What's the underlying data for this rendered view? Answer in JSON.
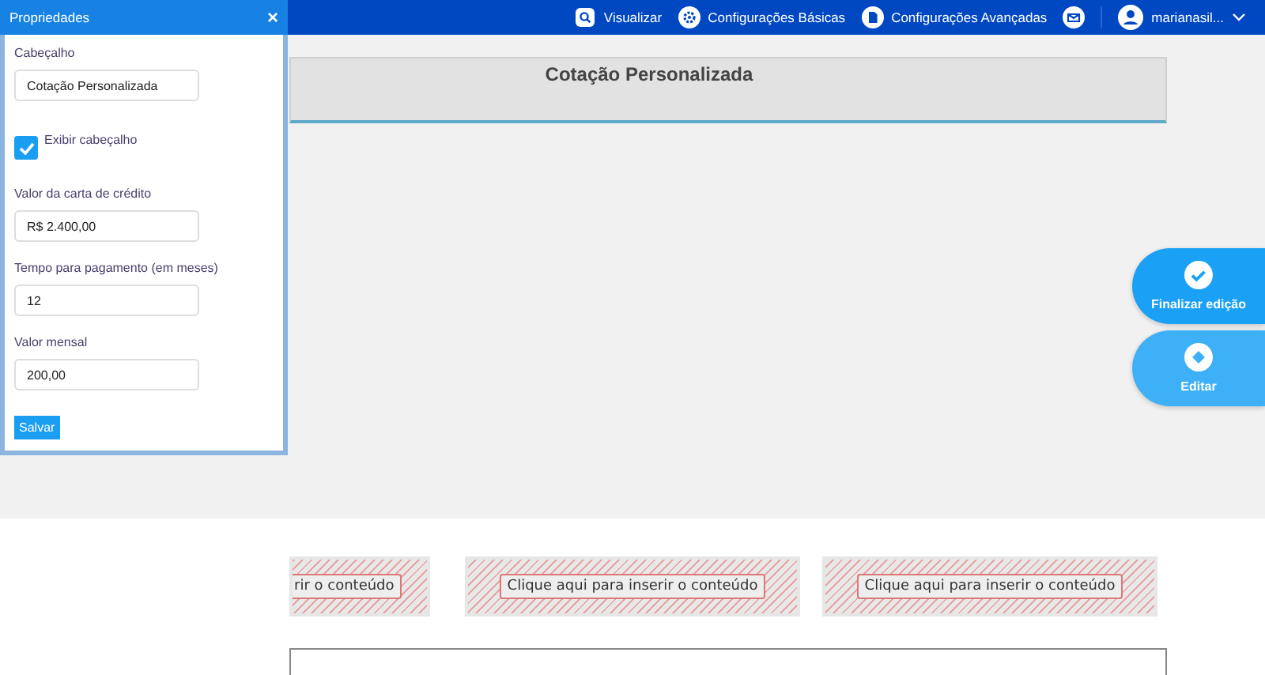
{
  "topbar": {
    "items": [
      {
        "kind": "preview",
        "label": "Visualizar"
      },
      {
        "kind": "gear",
        "label": "Configurações Básicas"
      },
      {
        "kind": "doc",
        "label": "Configurações Avançadas"
      },
      {
        "kind": "mail"
      },
      {
        "kind": "user",
        "label": "marianasil..."
      }
    ]
  },
  "panel": {
    "title": "Propriedades",
    "close": "×",
    "fields": [
      {
        "kind": "text",
        "label": "Cabeçalho",
        "value": "Cotação Personalizada"
      },
      {
        "kind": "checkbox",
        "label": "Exibir cabeçalho",
        "checked": true
      },
      {
        "kind": "text",
        "label": "Valor da carta de crédito",
        "value": "R$ 2.400,00"
      },
      {
        "kind": "text",
        "label": "Tempo para pagamento (em meses)",
        "value": "12"
      },
      {
        "kind": "text",
        "label": "Valor mensal",
        "value": "200,00"
      }
    ],
    "save": "Salvar"
  },
  "heading": {
    "title": "Cotação Personalizada"
  },
  "slots": [
    "rir o conteúdo",
    "Clique aqui para inserir o conteúdo",
    "Clique aqui para inserir o conteúdo"
  ],
  "actions": [
    {
      "kind": "check",
      "label": "Finalizar edição"
    },
    {
      "kind": "edit",
      "label": "Editar"
    }
  ]
}
